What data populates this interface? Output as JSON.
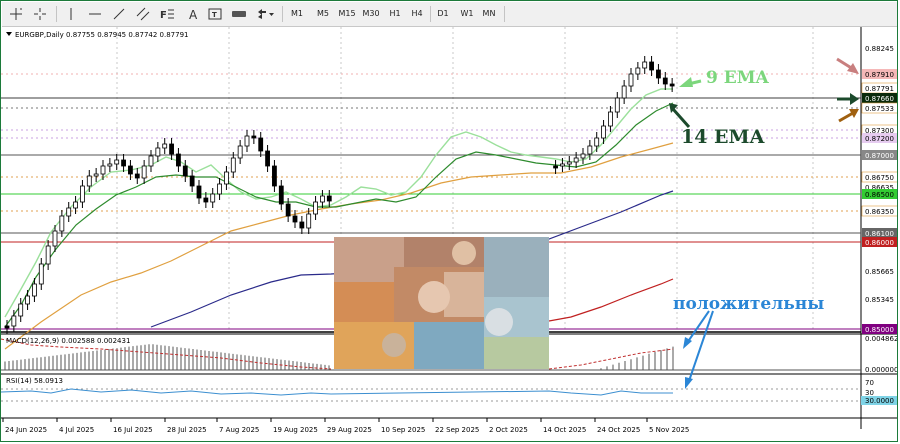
{
  "toolbar": {
    "timeframes": [
      "M1",
      "M5",
      "M15",
      "M30",
      "H1",
      "H4",
      "D1",
      "W1",
      "MN"
    ],
    "icons": [
      "crosshair-icon",
      "cursor-cross-icon",
      "vertical-line-icon",
      "horizontal-line-icon",
      "trend-line-icon",
      "channel-icon",
      "fibonacci-icon",
      "text-icon",
      "text-label-icon",
      "arrow-icon",
      "shapes-dropdown-icon"
    ]
  },
  "main_chart": {
    "header": "EURGBP,Daily  0.87755 0.87945 0.87742 0.87791",
    "price_labels": {
      "p1": "0.88245",
      "p2": "0.87910",
      "p3": "0.87791",
      "p4": "0.87660",
      "p5": "0.87533",
      "p6": "0.87300",
      "p7": "0.87200",
      "p8": "0.87000",
      "p9": "0.86750",
      "p10": "0.86635",
      "p11": "0.86500",
      "p12": "0.86350",
      "p13": "0.86100",
      "p14": "0.86000",
      "p15": "0.85665",
      "p16": "0.85345",
      "p17": "0.85000"
    }
  },
  "macd": {
    "header": "MACD(12,26,9) 0.002588 0.002431",
    "top_label": "0.004862",
    "bottom_label": "0.000000"
  },
  "rsi": {
    "header": "RSI(14) 58.0913",
    "level_70": "70",
    "level_30": "30",
    "value_label": "30.0000"
  },
  "x_axis": {
    "labels": [
      "24 Jun 2025",
      "4 Jul 2025",
      "16 Jul 2025",
      "28 Jul 2025",
      "7 Aug 2025",
      "19 Aug 2025",
      "29 Aug 2025",
      "10 Sep 2025",
      "22 Sep 2025",
      "2 Oct 2025",
      "14 Oct 2025",
      "24 Oct 2025",
      "5 Nov 2025"
    ]
  },
  "annotations": {
    "ema9": "9 EMA",
    "ema14": "14 EMA",
    "positive": "положительны"
  },
  "colors": {
    "ema9": "#9be09b",
    "ema14": "#2e8b2e",
    "ema_slow": "#e0a040",
    "ema_blue": "#2a2a8a",
    "ema_red": "#c02020",
    "annotation_green": "#7cd67c",
    "annotation_dark": "#1c4a2c",
    "annotation_blue": "#2b86d6"
  }
}
